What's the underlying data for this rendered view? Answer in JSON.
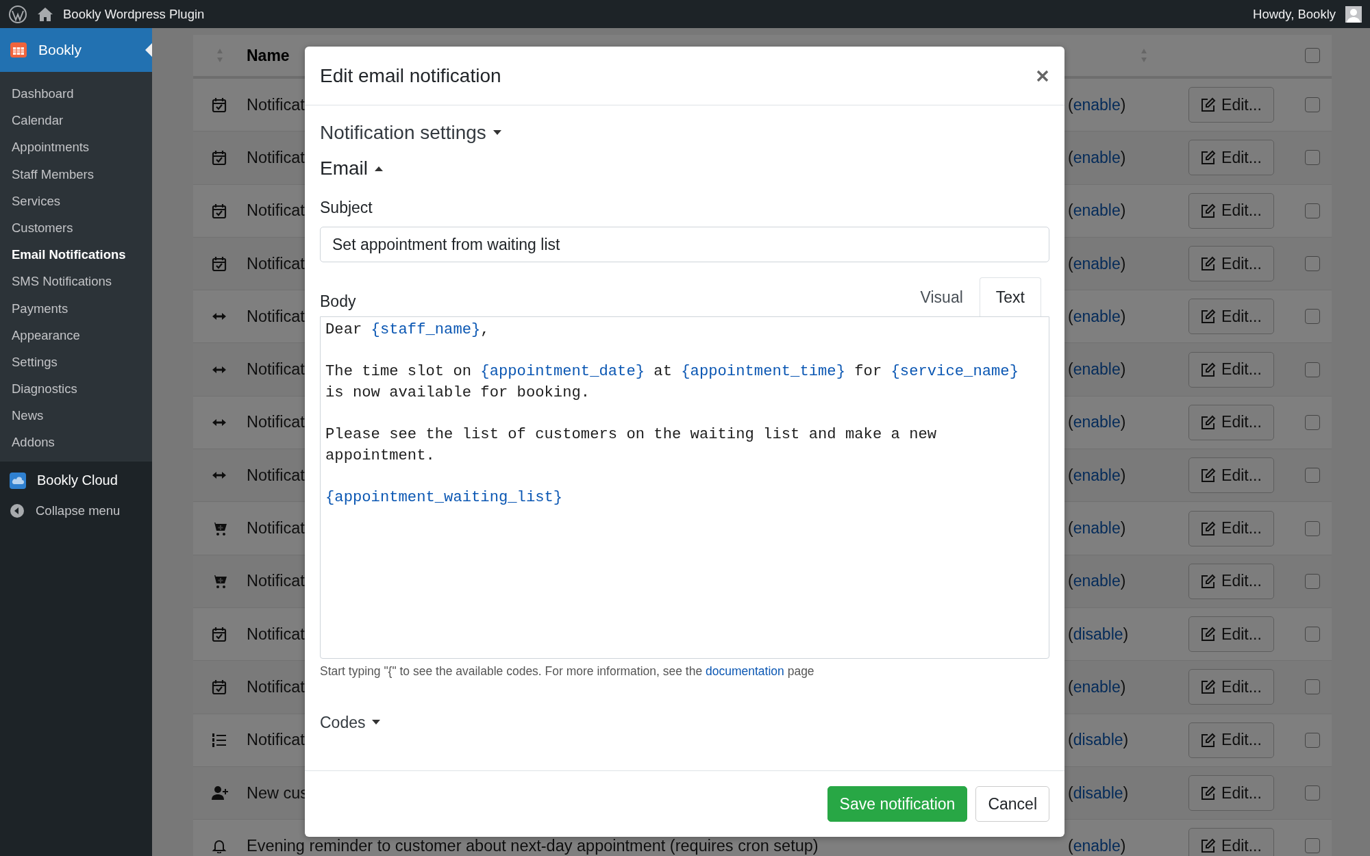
{
  "topbar": {
    "site_title": "Bookly Wordpress Plugin",
    "greeting": "Howdy, Bookly"
  },
  "sidebar": {
    "header": {
      "label": "Bookly",
      "selected": true
    },
    "items": [
      {
        "label": "Dashboard",
        "selected": false
      },
      {
        "label": "Calendar",
        "selected": false
      },
      {
        "label": "Appointments",
        "selected": false
      },
      {
        "label": "Staff Members",
        "selected": false
      },
      {
        "label": "Services",
        "selected": false
      },
      {
        "label": "Customers",
        "selected": false
      },
      {
        "label": "Email Notifications",
        "selected": true
      },
      {
        "label": "SMS Notifications",
        "selected": false
      },
      {
        "label": "Payments",
        "selected": false
      },
      {
        "label": "Appearance",
        "selected": false
      },
      {
        "label": "Settings",
        "selected": false
      },
      {
        "label": "Diagnostics",
        "selected": false
      },
      {
        "label": "News",
        "selected": false
      },
      {
        "label": "Addons",
        "selected": false
      }
    ],
    "cloud": "Bookly Cloud",
    "collapse": "Collapse menu"
  },
  "table": {
    "columns": [
      {
        "label": "Name"
      }
    ],
    "header_checked": false,
    "rows": [
      {
        "kind": "calendar",
        "name": "Notificat",
        "status": {
          "open": "(",
          "link": "enable",
          "close": ")"
        },
        "edit": "Edit...",
        "checked": false
      },
      {
        "kind": "calendar",
        "name": "Notificat",
        "status": {
          "open": "(",
          "link": "enable",
          "close": ")"
        },
        "edit": "Edit...",
        "checked": false
      },
      {
        "kind": "calendar",
        "name": "Notificat",
        "status": {
          "open": "(",
          "link": "enable",
          "close": ")"
        },
        "edit": "Edit...",
        "checked": false
      },
      {
        "kind": "calendar",
        "name": "Notificat",
        "status": {
          "open": "(",
          "link": "enable",
          "close": ")"
        },
        "edit": "Edit...",
        "checked": false
      },
      {
        "kind": "arrows",
        "name": "Notificat",
        "status": {
          "open": "(",
          "link": "enable",
          "close": ")"
        },
        "edit": "Edit...",
        "checked": false
      },
      {
        "kind": "arrows",
        "name": "Notificat",
        "status": {
          "open": "(",
          "link": "enable",
          "close": ")"
        },
        "edit": "Edit...",
        "checked": false
      },
      {
        "kind": "arrows",
        "name": "Notificat",
        "status": {
          "open": "(",
          "link": "enable",
          "close": ")"
        },
        "edit": "Edit...",
        "checked": false
      },
      {
        "kind": "arrows",
        "name": "Notificat",
        "status": {
          "open": "(",
          "link": "enable",
          "close": ")"
        },
        "edit": "Edit...",
        "checked": false
      },
      {
        "kind": "cart",
        "name": "Notificat",
        "status": {
          "open": "(",
          "link": "enable",
          "close": ")"
        },
        "edit": "Edit...",
        "checked": false
      },
      {
        "kind": "cart",
        "name": "Notificat",
        "status": {
          "open": "(",
          "link": "enable",
          "close": ")"
        },
        "edit": "Edit...",
        "checked": false
      },
      {
        "kind": "calendar",
        "name": "Notificat",
        "status": {
          "open": "(",
          "link": "disable",
          "close": ")"
        },
        "edit": "Edit...",
        "checked": false
      },
      {
        "kind": "calendar",
        "name": "Notificat",
        "status": {
          "open": "(",
          "link": "enable",
          "close": ")"
        },
        "edit": "Edit...",
        "checked": false
      },
      {
        "kind": "list",
        "name": "Notificat",
        "status": {
          "open": "(",
          "link": "disable",
          "close": ")"
        },
        "edit": "Edit...",
        "checked": false
      },
      {
        "kind": "user",
        "name": "New cus",
        "status": {
          "open": "(",
          "link": "disable",
          "close": ")"
        },
        "edit": "Edit...",
        "checked": false
      },
      {
        "kind": "bell",
        "name": "Evening reminder to customer about next-day appointment (requires cron setup)",
        "status": {
          "open": "(",
          "link": "enable",
          "close": ")"
        },
        "edit": "Edit...",
        "checked": false
      }
    ]
  },
  "modal": {
    "title": "Edit email notification",
    "sections": [
      {
        "label": "Notification settings",
        "expanded": false
      },
      {
        "label": "Email",
        "expanded": true
      }
    ],
    "subject": {
      "label": "Subject",
      "value": "Set appointment from waiting list"
    },
    "body": {
      "label": "Body",
      "tabs": [
        {
          "label": "Visual",
          "selected": false
        },
        {
          "label": "Text",
          "selected": true
        }
      ],
      "paragraphs": [
        [
          [
            {
              "kind": "text",
              "text": "Dear "
            },
            {
              "kind": "code",
              "text": "{staff_name}"
            },
            {
              "kind": "text",
              "text": ","
            }
          ]
        ],
        [
          [
            {
              "kind": "text",
              "text": "The time slot on "
            },
            {
              "kind": "code",
              "text": "{appointment_date}"
            },
            {
              "kind": "text",
              "text": " at "
            },
            {
              "kind": "code",
              "text": "{appointment_time}"
            },
            {
              "kind": "text",
              "text": " for "
            },
            {
              "kind": "code",
              "text": "{service_name}"
            }
          ],
          [
            {
              "kind": "text",
              "text": "is now available for booking."
            }
          ]
        ],
        [
          [
            {
              "kind": "text",
              "text": "Please see the list of customers on the waiting list and make a new"
            }
          ],
          [
            {
              "kind": "text",
              "text": "appointment."
            }
          ]
        ],
        [
          [
            {
              "kind": "code",
              "text": "{appointment_waiting_list}"
            }
          ]
        ]
      ]
    },
    "hint": {
      "before": "Start typing \"{\" to see the available codes. For more information, see the ",
      "link": "documentation",
      "after": " page"
    },
    "codes": {
      "label": "Codes",
      "expanded": false
    },
    "buttons": {
      "save": "Save notification",
      "cancel": "Cancel"
    }
  }
}
